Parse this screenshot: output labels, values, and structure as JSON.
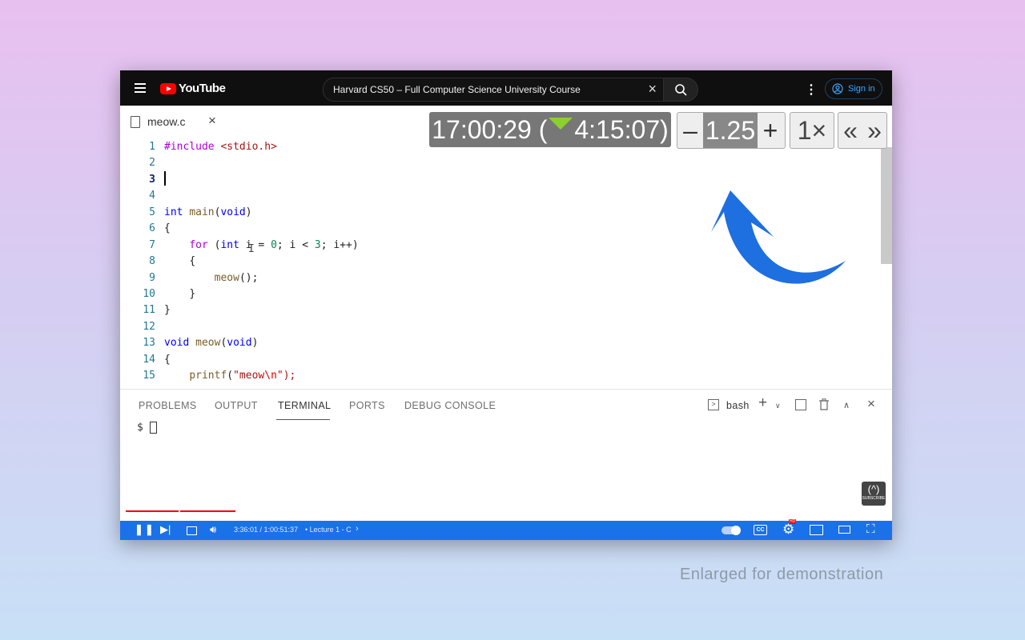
{
  "youtube": {
    "logo_text": "YouTube",
    "search_value": "Harvard CS50 – Full Computer Science University Course",
    "signin_label": "Sign in"
  },
  "editor": {
    "file_name": "meow.c",
    "active_line": 3,
    "lines": [
      {
        "n": "1"
      },
      {
        "n": "2"
      },
      {
        "n": "3"
      },
      {
        "n": "4"
      },
      {
        "n": "5"
      },
      {
        "n": "6"
      },
      {
        "n": "7"
      },
      {
        "n": "8"
      },
      {
        "n": "9"
      },
      {
        "n": "10"
      },
      {
        "n": "11"
      },
      {
        "n": "12"
      },
      {
        "n": "13"
      },
      {
        "n": "14"
      },
      {
        "n": "15"
      }
    ],
    "code": {
      "l1_directive": "#include",
      "l1_header": "<stdio.h>",
      "l5_type": "int",
      "l5_name": "main",
      "l5_arg": "void",
      "l6": "{",
      "l7_for": "for",
      "l7_int": "int",
      "l7_a": " i = ",
      "l7_zero": "0",
      "l7_b": "; i < ",
      "l7_three": "3",
      "l7_c": "; i++)",
      "l8": "{",
      "l9_fn": "meow",
      "l9_rest": "();",
      "l10": "}",
      "l11": "}",
      "l13_type": "void",
      "l13_name": "meow",
      "l13_arg": "void",
      "l14": "{",
      "l15_fn": "printf",
      "l15_str": "\"meow",
      "l15_esc": "\\n",
      "l15_end": "\");"
    }
  },
  "overlay": {
    "elapsed": "17:00:29 (",
    "remaining": "4:15:07)",
    "speed_minus": "–",
    "speed_value": "1.25",
    "speed_plus": "+",
    "reset_label": "1×",
    "skip_back": "«",
    "skip_forward": "»"
  },
  "panel": {
    "tabs": [
      "PROBLEMS",
      "OUTPUT",
      "TERMINAL",
      "PORTS",
      "DEBUG CONSOLE"
    ],
    "active_tab": "TERMINAL",
    "shell_label": "bash",
    "prompt": "$"
  },
  "player": {
    "time": "3:36:01 / 1:00:51:37",
    "chapter": "• Lecture 1 - C",
    "settings_badge": "HD",
    "subscribe_label": "SUBSCRIBE"
  },
  "caption": "Enlarged for demonstration",
  "colors": {
    "accent_blue": "#1b71e8",
    "youtube_red": "#ff0000",
    "arrow_blue": "#1e6fe0"
  }
}
